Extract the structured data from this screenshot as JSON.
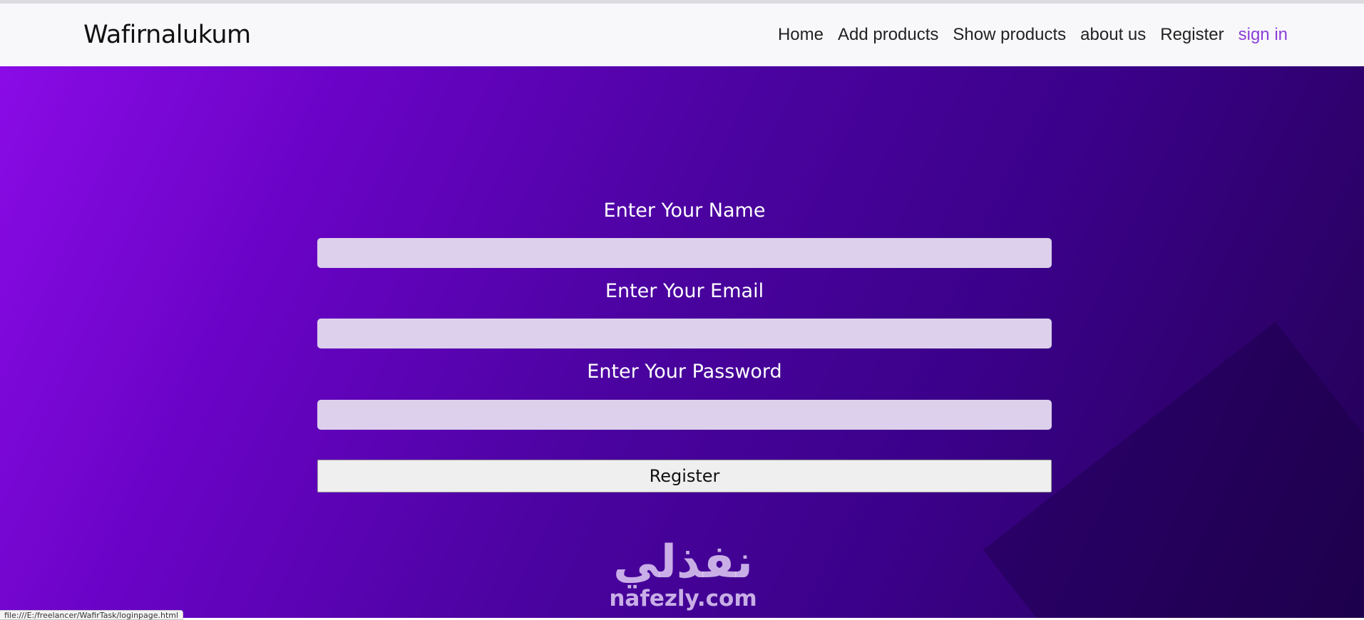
{
  "navbar": {
    "brand": "Wafirnalukum",
    "links": [
      {
        "label": "Home"
      },
      {
        "label": "Add products"
      },
      {
        "label": "Show products"
      },
      {
        "label": "about us"
      },
      {
        "label": "Register"
      },
      {
        "label": "sign in",
        "active": true
      }
    ]
  },
  "form": {
    "name_label": "Enter Your Name",
    "name_value": "",
    "email_label": "Enter Your Email",
    "email_value": "",
    "password_label": "Enter Your Password",
    "password_value": "",
    "submit_label": "Register"
  },
  "watermark": {
    "arabic": "نفذلي",
    "latin": "nafezly.com"
  },
  "status_bar": {
    "url": "file:///E:/freelancer/WafirTask/loginpage.html"
  },
  "colors": {
    "accent_link": "#8a3fd6",
    "gradient_start": "#8a0be6",
    "gradient_end": "#220155",
    "input_bg": "#ddd0ec"
  }
}
